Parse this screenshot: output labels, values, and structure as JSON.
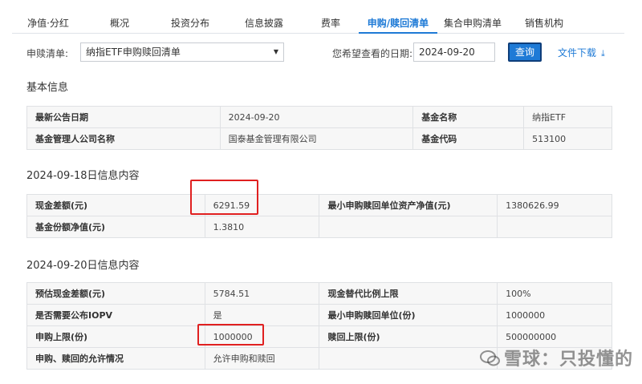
{
  "tabs": [
    {
      "label": "净值·分红",
      "active": false
    },
    {
      "label": "概况",
      "active": false
    },
    {
      "label": "投资分布",
      "active": false
    },
    {
      "label": "信息披露",
      "active": false
    },
    {
      "label": "费率",
      "active": false
    },
    {
      "label": "申购/赎回清单",
      "active": true
    },
    {
      "label": "集合申购清单",
      "active": false
    },
    {
      "label": "销售机构",
      "active": false
    }
  ],
  "filter": {
    "list_label": "申赎清单:",
    "list_value": "纳指ETF申购赎回清单",
    "date_label": "您希望查看的日期:",
    "date_value": "2024-09-20",
    "query_button": "查询",
    "download_label": "文件下载"
  },
  "basic": {
    "title": "基本信息",
    "rows": [
      [
        "最新公告日期",
        "2024-09-20",
        "基金名称",
        "纳指ETF"
      ],
      [
        "基金管理人公司名称",
        "国泰基金管理有限公司",
        "基金代码",
        "513100"
      ]
    ]
  },
  "sec1": {
    "title": "2024-09-18日信息内容",
    "rows": [
      [
        "现金差额(元)",
        "6291.59",
        "最小申购赎回单位资产净值(元)",
        "1380626.99"
      ],
      [
        "基金份额净值(元)",
        "1.3810",
        "",
        ""
      ]
    ]
  },
  "sec2": {
    "title": "2024-09-20日信息内容",
    "rows": [
      [
        "预估现金差额(元)",
        "5784.51",
        "现金替代比例上限",
        "100%"
      ],
      [
        "是否需要公布IOPV",
        "是",
        "最小申购赎回单位(份)",
        "1000000"
      ],
      [
        "申购上限(份)",
        "1000000",
        "赎回上限(份)",
        "500000000"
      ],
      [
        "申购、赎回的允许情况",
        "允许申购和赎回",
        "",
        ""
      ]
    ]
  },
  "watermark": "雪球：只投懂的",
  "colors": {
    "accent": "#1e7ad6",
    "highlight": "#e02020"
  }
}
